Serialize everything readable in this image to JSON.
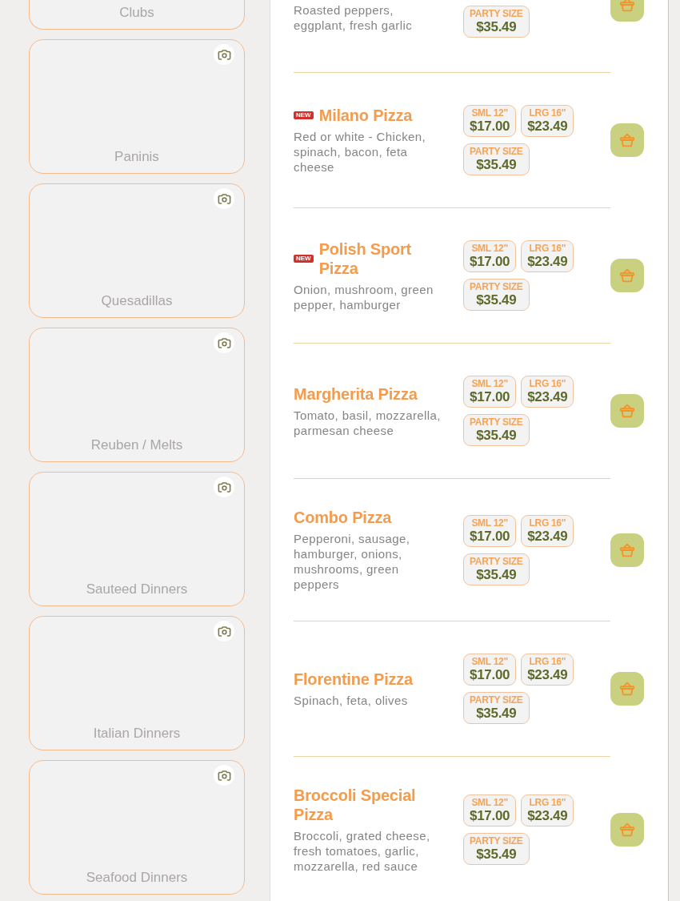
{
  "categories": [
    {
      "kind": "cut_off",
      "label": "Clubs"
    },
    {
      "kind": "full",
      "label": "Paninis"
    },
    {
      "kind": "full",
      "label": "Quesadillas"
    },
    {
      "kind": "full",
      "label": "Reuben / Melts"
    },
    {
      "kind": "full",
      "label": "Sauteed Dinners"
    },
    {
      "kind": "full",
      "label": "Italian Dinners"
    },
    {
      "kind": "full",
      "label": "Seafood Dinners"
    }
  ],
  "menu_items": [
    {
      "kind": "cut_off",
      "description": "Roasted peppers, eggplant, fresh garlic",
      "prices": [
        {
          "label": "PARTY SIZE",
          "price": "$35.49"
        }
      ]
    },
    {
      "kind": "full",
      "badge": "NEW",
      "title": "Milano Pizza",
      "description": "Red or white - Chicken, spinach, bacon, feta cheese",
      "prices": [
        {
          "label": "SML 12\"",
          "price": "$17.00"
        },
        {
          "label": "LRG 16\"",
          "price": "$23.49"
        },
        {
          "label": "PARTY SIZE",
          "price": "$35.49"
        }
      ]
    },
    {
      "kind": "full",
      "badge": "NEW",
      "title": "Polish Sport Pizza",
      "description": "Onion, mushroom, green pepper, hamburger",
      "prices": [
        {
          "label": "SML 12\"",
          "price": "$17.00"
        },
        {
          "label": "LRG 16\"",
          "price": "$23.49"
        },
        {
          "label": "PARTY SIZE",
          "price": "$35.49"
        }
      ]
    },
    {
      "kind": "full",
      "title": "Margherita Pizza",
      "description": "Tomato, basil, mozzarella, parmesan cheese",
      "prices": [
        {
          "label": "SML 12\"",
          "price": "$17.00"
        },
        {
          "label": "LRG 16\"",
          "price": "$23.49"
        },
        {
          "label": "PARTY SIZE",
          "price": "$35.49"
        }
      ]
    },
    {
      "kind": "full",
      "title": "Combo Pizza",
      "description": "Pepperoni, sausage, hamburger, onions, mushrooms, green peppers",
      "prices": [
        {
          "label": "SML 12\"",
          "price": "$17.00"
        },
        {
          "label": "LRG 16\"",
          "price": "$23.49"
        },
        {
          "label": "PARTY SIZE",
          "price": "$35.49"
        }
      ]
    },
    {
      "kind": "full",
      "title": "Florentine Pizza",
      "description": "Spinach, feta, olives",
      "prices": [
        {
          "label": "SML 12\"",
          "price": "$17.00"
        },
        {
          "label": "LRG 16\"",
          "price": "$23.49"
        },
        {
          "label": "PARTY SIZE",
          "price": "$35.49"
        }
      ]
    },
    {
      "kind": "full",
      "title": "Broccoli Special Pizza",
      "description": "Broccoli, grated cheese, fresh tomatoes, garlic, mozzarella, red sauce",
      "prices": [
        {
          "label": "SML 12\"",
          "price": "$17.00"
        },
        {
          "label": "LRG 16\"",
          "price": "$23.49"
        },
        {
          "label": "PARTY SIZE",
          "price": "$35.49"
        }
      ]
    }
  ]
}
